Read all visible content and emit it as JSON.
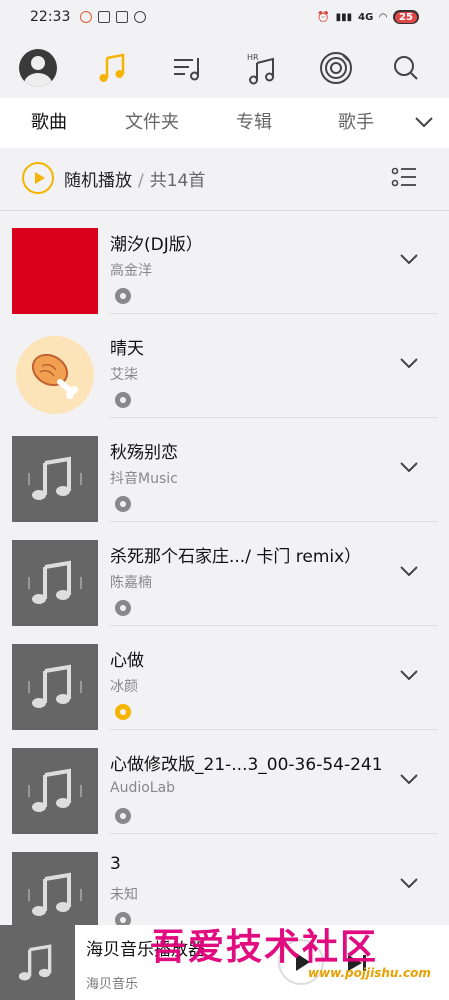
{
  "status_bar": {
    "time": "22:33",
    "battery": "25",
    "network": "4G"
  },
  "top_nav": {
    "icons": [
      "avatar",
      "music-note-icon",
      "playlist-icon",
      "hr-music-icon",
      "radio-disc-icon",
      "search-icon"
    ],
    "accent": "#f5b400"
  },
  "tabs": [
    {
      "label": "歌曲",
      "active": true
    },
    {
      "label": "文件夹",
      "active": false
    },
    {
      "label": "专辑",
      "active": false
    },
    {
      "label": "歌手",
      "active": false
    }
  ],
  "header": {
    "shuffle_label": "随机播放",
    "separator": "/",
    "count_label": "共14首"
  },
  "songs": [
    {
      "title": "潮汐(DJ版）",
      "artist": "高金洋"
    },
    {
      "title": "晴天",
      "artist": "艾柒"
    },
    {
      "title": "秋殇别恋",
      "artist": "抖音Music"
    },
    {
      "title": "杀死那个石家庄.../ 卡门 remix）",
      "artist": "陈嘉楠"
    },
    {
      "title": "心做",
      "artist": "冰颜"
    },
    {
      "title": "心做修改版_21-...3_00-36-54-241",
      "artist": "AudioLab"
    },
    {
      "title": "3",
      "artist": "未知"
    }
  ],
  "player": {
    "title": "海贝音乐播放器",
    "subtitle": "海贝音乐"
  },
  "watermark": {
    "text": "吾爱技术社区",
    "url": "www.pojjishu.com"
  }
}
